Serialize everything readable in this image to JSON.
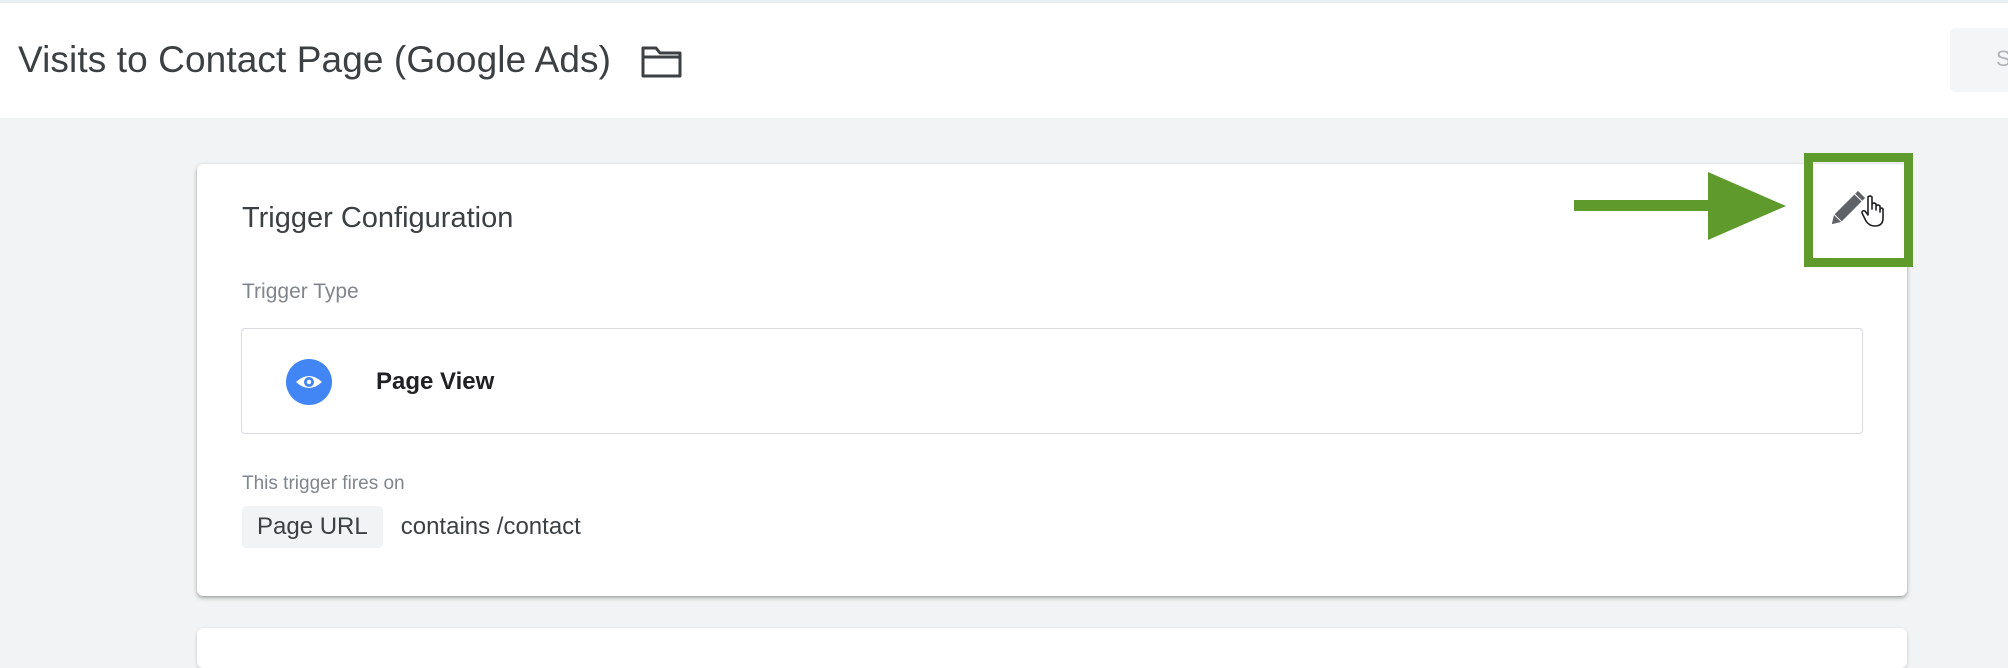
{
  "header": {
    "title": "Visits to Contact Page (Google Ads)",
    "save_label": "S"
  },
  "trigger_config": {
    "title": "Trigger Configuration",
    "type_label": "Trigger Type",
    "type_name": "Page View",
    "fires_on_label": "This trigger fires on",
    "condition": {
      "variable": "Page URL",
      "operator_value": "contains /contact"
    }
  },
  "icons": {
    "folder": "folder-icon",
    "edit": "pencil-icon",
    "trigger_type": "eye-icon",
    "cursor": "hand-cursor-icon"
  },
  "colors": {
    "highlight": "#5f9a2d",
    "trigger_icon": "#4285f4",
    "background": "#f1f3f4"
  }
}
